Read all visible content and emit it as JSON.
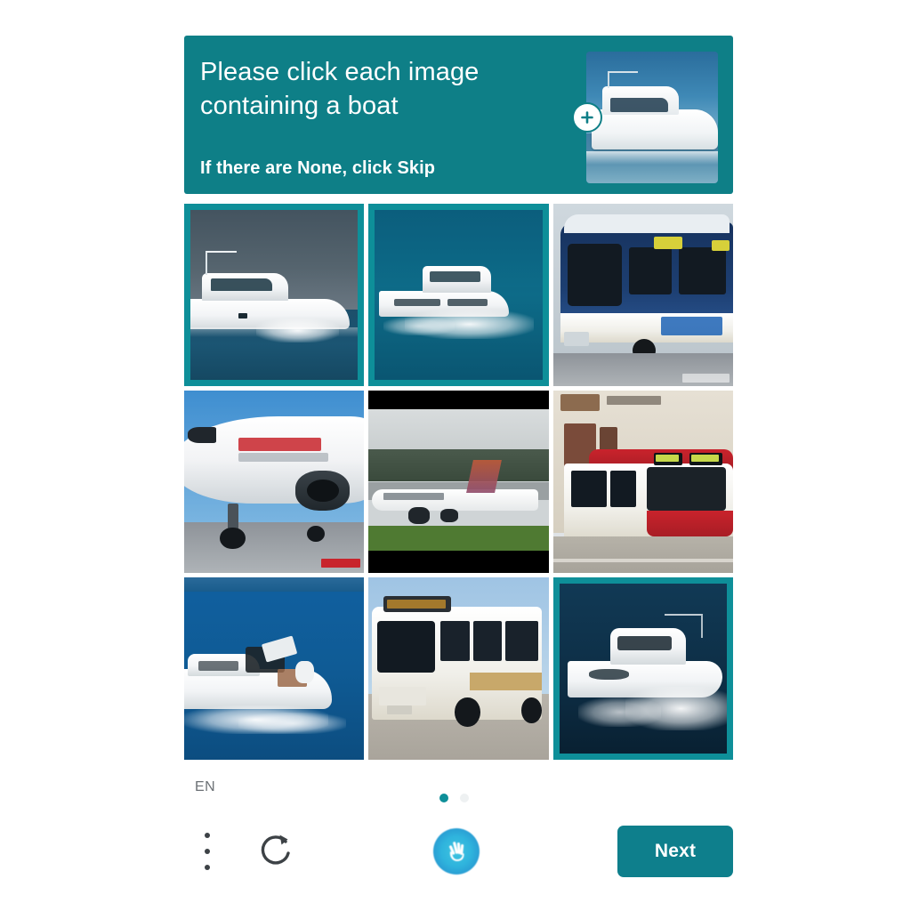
{
  "prompt": {
    "main_text": "Please click each image\ncontaining a boat",
    "sub_text": "If there are None, click Skip",
    "target_object": "boat",
    "example_image_alt": "white yacht on blue water",
    "expand_icon": "plus-circle-icon"
  },
  "theme": {
    "accent": "#0e7f87",
    "selection_border": "#0e8f99",
    "button": "#0e7f8c",
    "text_on_accent": "#ffffff",
    "page_background": "#ffffff"
  },
  "grid": {
    "columns": 3,
    "rows": 3,
    "tiles": [
      {
        "index": 0,
        "alt": "white yacht on dark sea under gray sky",
        "category": "boat",
        "selected": true
      },
      {
        "index": 1,
        "alt": "white motor yacht speeding on teal sea",
        "category": "boat",
        "selected": true
      },
      {
        "index": 2,
        "alt": "blue and white city bus at depot",
        "category": "bus",
        "selected": false
      },
      {
        "index": 3,
        "alt": "white airliner nose on tarmac",
        "category": "airplane",
        "selected": false
      },
      {
        "index": 4,
        "alt": "airliner on runway with trees behind",
        "category": "airplane",
        "selected": false
      },
      {
        "index": 5,
        "alt": "red and white bus on street by building",
        "category": "bus",
        "selected": false
      },
      {
        "index": 6,
        "alt": "white speedboat on deep blue water",
        "category": "boat",
        "selected": false
      },
      {
        "index": 7,
        "alt": "white and tan city bus",
        "category": "bus",
        "selected": false
      },
      {
        "index": 8,
        "alt": "white yacht cruising with white wake",
        "category": "boat",
        "selected": true
      }
    ]
  },
  "footer": {
    "language": "EN",
    "menu_icon": "more-vertical-icon",
    "refresh_icon": "refresh-icon",
    "accessibility_icon": "hand-icon",
    "next_label": "Next",
    "pagination": {
      "total": 2,
      "active_index": 0
    }
  }
}
